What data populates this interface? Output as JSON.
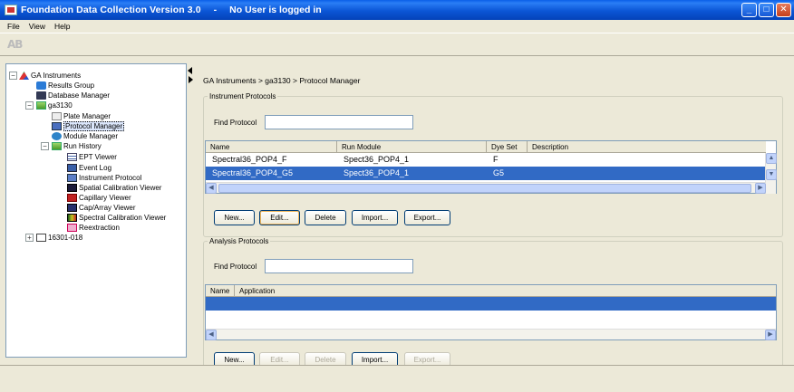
{
  "window": {
    "title": "Foundation Data Collection Version 3.0",
    "separator": "-",
    "user_status": "No User is logged in"
  },
  "menu": [
    "File",
    "View",
    "Help"
  ],
  "toolbar": {
    "logo": "AB"
  },
  "tree": {
    "items": [
      "GA Instruments",
      "Results Group",
      "Database Manager",
      "ga3130",
      "Plate Manager",
      "Protocol Manager",
      "Module Manager",
      "Run History",
      "EPT Viewer",
      "Event Log",
      "Instrument Protocol",
      "Spatial Calibration Viewer",
      "Capillary Viewer",
      "Cap/Array Viewer",
      "Spectral Calibration Viewer",
      "Reextraction",
      "16301-018"
    ],
    "expanders": [
      "−",
      "−",
      "−",
      "+"
    ]
  },
  "breadcrumb": "GA Instruments > ga3130 > Protocol Manager",
  "instrument_protocols": {
    "legend": "Instrument Protocols",
    "find_label": "Find Protocol",
    "find_value": "",
    "columns": [
      "Name",
      "Run Module",
      "Dye Set",
      "Description"
    ],
    "rows": [
      [
        "Spectral36_POP4_F",
        "Spect36_POP4_1",
        "F",
        ""
      ],
      [
        "Spectral36_POP4_G5",
        "Spect36_POP4_1",
        "G5",
        ""
      ]
    ],
    "selected_row": 1,
    "buttons": [
      "New...",
      "Edit...",
      "Delete",
      "Import...",
      "Export..."
    ]
  },
  "analysis_protocols": {
    "legend": "Analysis Protocols",
    "find_label": "Find Protocol",
    "find_value": "",
    "columns": [
      "Name",
      "Application"
    ],
    "rows": [],
    "buttons": [
      "New...",
      "Edit...",
      "Delete",
      "Import...",
      "Export..."
    ],
    "disabled_buttons": [
      "Edit...",
      "Delete",
      "Export..."
    ]
  },
  "scroll_glyphs": {
    "up": "▲",
    "down": "▼",
    "left": "◀",
    "right": "▶"
  },
  "window_controls": {
    "minimize": "_",
    "maximize": "□",
    "close": "✕"
  },
  "colors": {
    "titlebar": "#0b56d6",
    "selection": "#316ac5",
    "window_bg": "#ece9d8"
  }
}
